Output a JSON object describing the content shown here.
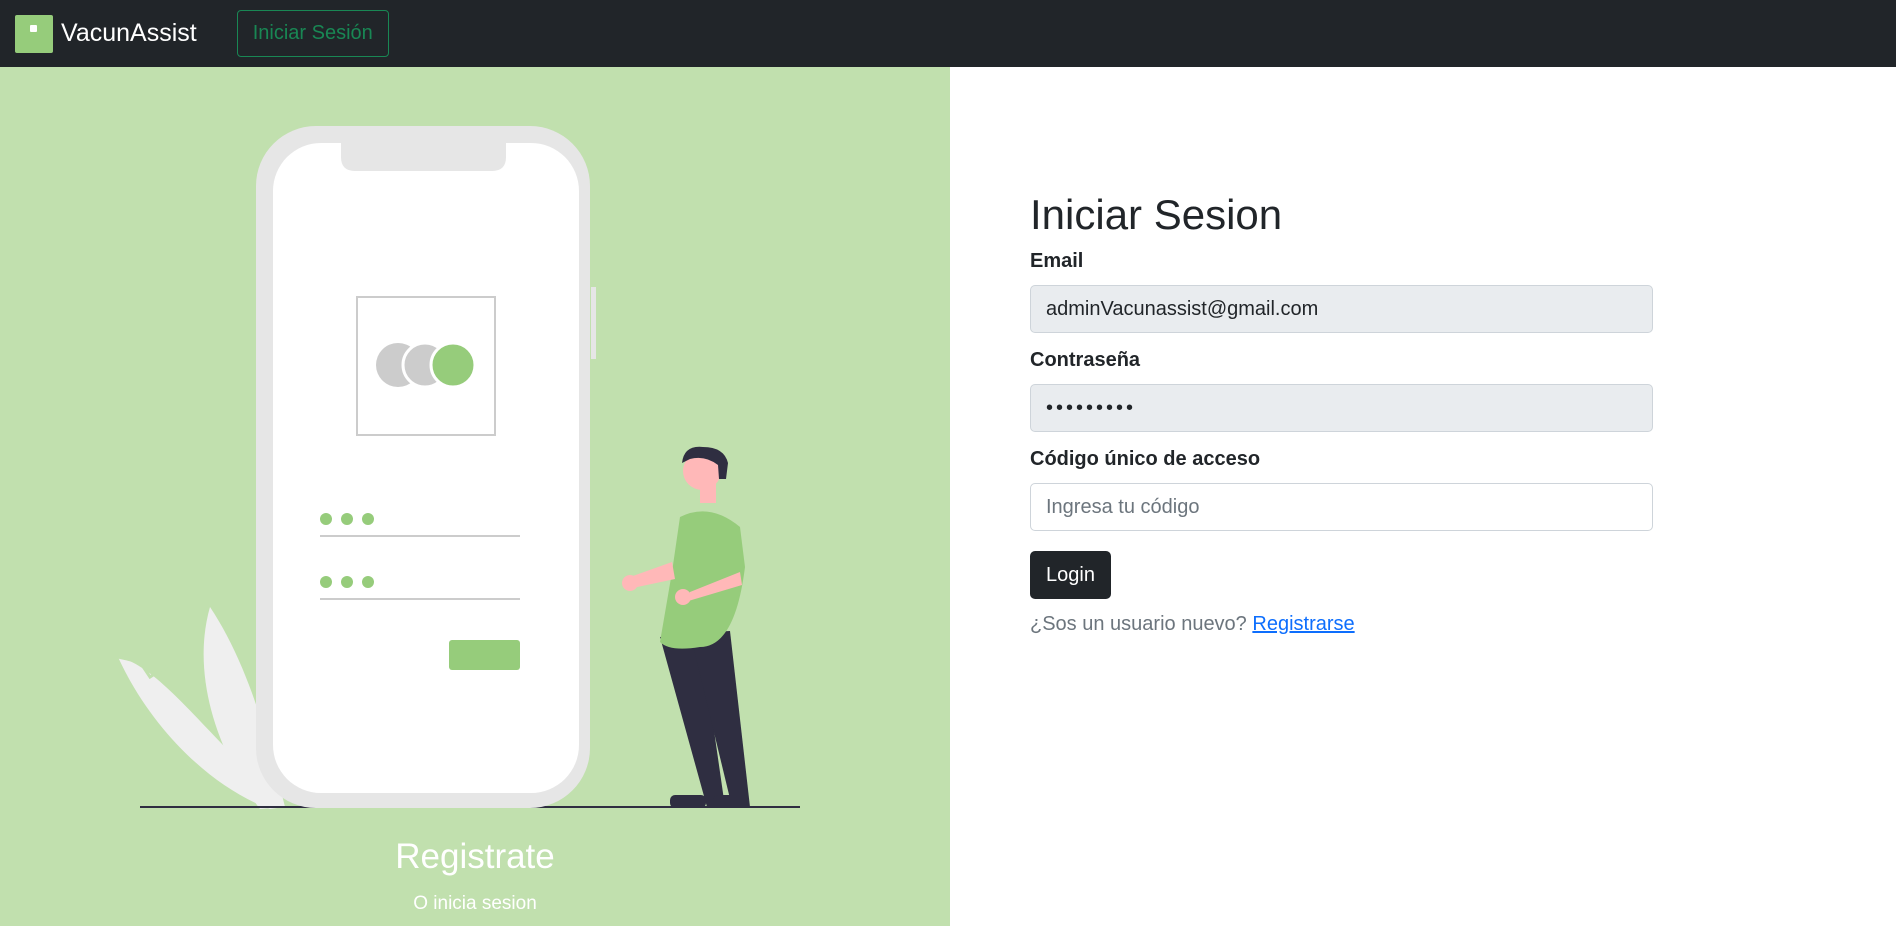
{
  "navbar": {
    "brand": "VacunAssist",
    "login_button": "Iniciar Sesión"
  },
  "promo": {
    "title": "Registrate",
    "subtitle": "O inicia sesion"
  },
  "login_form": {
    "title": "Iniciar Sesion",
    "email_label": "Email",
    "email_value": "adminVacunassist@gmail.com",
    "password_label": "Contraseña",
    "password_value": "•••••••••",
    "code_label": "Código único de acceso",
    "code_placeholder": "Ingresa tu código",
    "submit_label": "Login",
    "signup_prompt": "¿Sos un usuario nuevo?",
    "signup_link": "Registrarse"
  },
  "colors": {
    "navbar_bg": "#212529",
    "accent_green": "#96cc7b",
    "panel_green": "#c1e0ae",
    "outline_green": "#198754",
    "link_blue": "#0d6efd"
  },
  "icons": {
    "brand": "app-logo-icon",
    "illustration": "phone-login-illustration"
  }
}
